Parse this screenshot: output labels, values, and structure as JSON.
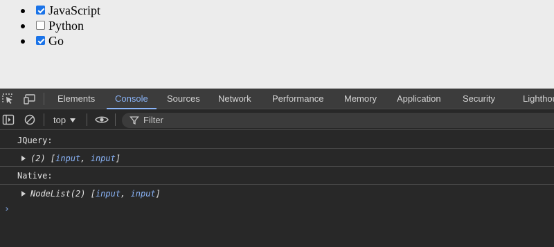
{
  "page": {
    "items": [
      {
        "label": "JavaScript",
        "checked": true
      },
      {
        "label": "Python",
        "checked": false
      },
      {
        "label": "Go",
        "checked": true
      }
    ]
  },
  "devtools": {
    "tabs": [
      "Elements",
      "Console",
      "Sources",
      "Network",
      "Performance",
      "Memory",
      "Application",
      "Security",
      "Lighthouse"
    ],
    "active_tab": "Console",
    "context": "top",
    "filter_placeholder": "Filter",
    "console": {
      "jquery_label": "JQuery:",
      "jquery_count": "(2)",
      "item_a": "input",
      "item_b": "input",
      "native_label": "Native:",
      "nodelist_prefix": "NodeList(2)",
      "item_c": "input",
      "item_d": "input",
      "prompt": "›"
    },
    "colors": {
      "accent": "#8ab4f8",
      "panel_bg": "#282828",
      "tabbar_bg": "#3c3c3c",
      "checkbox": "#1a73e8"
    }
  }
}
